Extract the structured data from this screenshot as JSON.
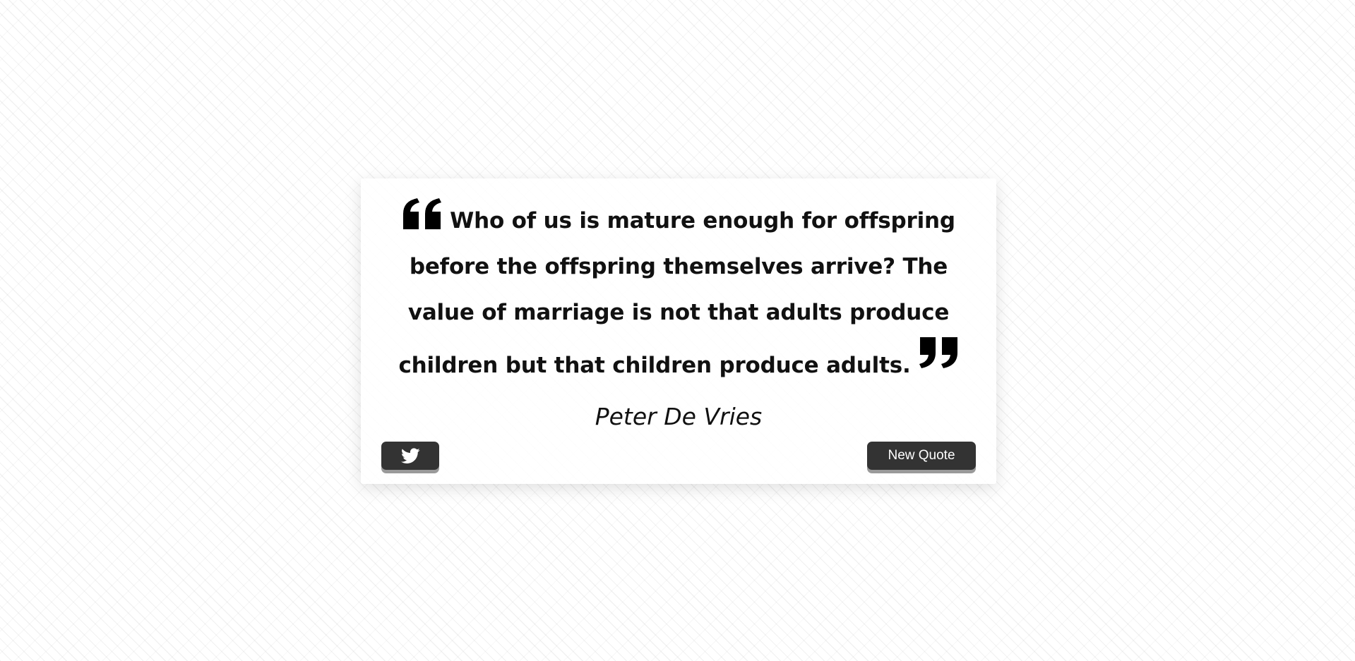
{
  "quote": {
    "text": "Who of us is mature enough for offspring before the offspring themselves arrive? The value of marriage is not that adults produce children but that children produce adults.",
    "author": "Peter De Vries",
    "open_icon": "quote-left-icon",
    "close_icon": "quote-right-icon"
  },
  "actions": {
    "tweet_icon": "twitter-icon",
    "new_quote_label": "New Quote"
  },
  "colors": {
    "button_bg": "#333333",
    "button_text": "#ffffff",
    "text": "#111111"
  }
}
